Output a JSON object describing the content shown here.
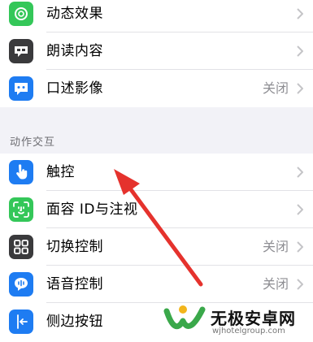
{
  "group1": {
    "rows": [
      {
        "label": "动态效果",
        "value": "",
        "icon": "motion-icon",
        "color": "#34c759"
      },
      {
        "label": "朗读内容",
        "value": "",
        "icon": "speech-bubble-icon",
        "color": "#3a3a3c"
      },
      {
        "label": "口述影像",
        "value": "关闭",
        "icon": "audio-description-icon",
        "color": "#1e7cf2"
      }
    ]
  },
  "section_header": "动作交互",
  "group2": {
    "rows": [
      {
        "label": "触控",
        "value": "",
        "icon": "hand-touch-icon",
        "color": "#1e7cf2"
      },
      {
        "label": "面容 ID与注视",
        "value": "",
        "icon": "face-id-icon",
        "color": "#34c759"
      },
      {
        "label": "切换控制",
        "value": "关闭",
        "icon": "switch-control-icon",
        "color": "#3a3a3c"
      },
      {
        "label": "语音控制",
        "value": "关闭",
        "icon": "voice-control-icon",
        "color": "#1e7cf2"
      },
      {
        "label": "侧边按钮",
        "value": "",
        "icon": "side-button-icon",
        "color": "#1e7cf2"
      }
    ]
  },
  "watermark": {
    "title": "无极安卓网",
    "url": "wjhotelgroup.com"
  }
}
